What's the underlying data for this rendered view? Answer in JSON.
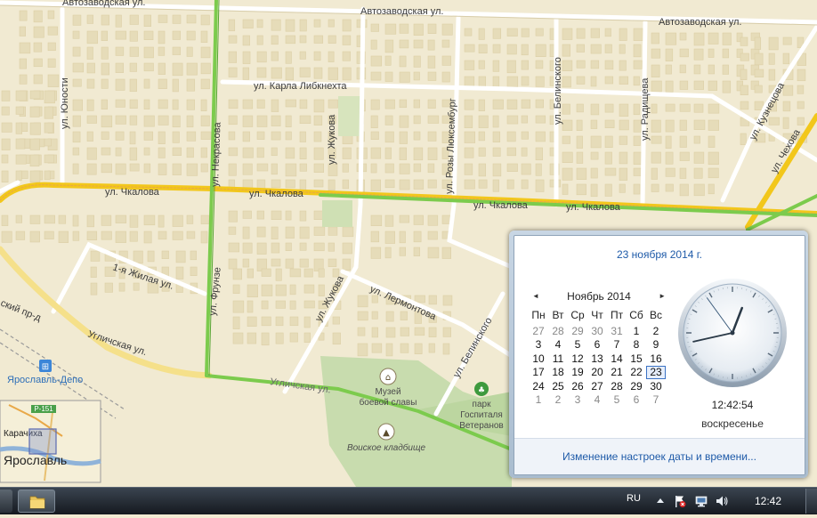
{
  "map": {
    "streets": {
      "avtozavodskaya_1": "Автозаводская ул.",
      "avtozavodskaya_2": "Автозаводская ул.",
      "karla_libknehta": "ул. Карла Либкнехта",
      "chkalova_1": "ул. Чкалова",
      "chkalova_2": "ул. Чкалова",
      "chkalova_3": "ул. Чкалова",
      "chkalova_4": "ул. Чкалова",
      "yunosti": "ул. Юности",
      "nekrasova_partial": "ул. Некрасова",
      "zhukova_1": "ул. Жукова",
      "zhukova_2": "ул. Жукова",
      "rozy_lyuksemburg": "ул. Розы Люксембург",
      "belinskogo_1": "ул. Белинского",
      "belinskogo_2": "ул. Белинского",
      "radishcheva": "ул. Радищева",
      "kuznecova": "ул. Кузнецова",
      "zhilaya": "1-я Жилая ул.",
      "lermontova": "ул. Лермонтова",
      "uglichskaya_1": "Угличская ул.",
      "uglichskaya_2": "Угличская ул.",
      "frolova_partial": "ул. Фрунзе",
      "proezd_partial": "ский пр-д",
      "chekhova_partial": "ул. Чехова"
    },
    "pois": {
      "station": "Ярославль-Депо",
      "museum_line1": "Музей",
      "museum_line2": "боевой славы",
      "cemetery": "Воиское кладбище",
      "park_line1": "парк",
      "park_line2": "Госпиталя",
      "park_line3": "Ветеранов"
    },
    "minimap": {
      "road_label": "Р-151",
      "town": "Карачиха",
      "city": "Ярославль"
    },
    "colors": {
      "background": "#f1ead2",
      "block": "#e4dab8",
      "green_traffic": "#7ccb4d",
      "yellow_traffic": "#f2c71b"
    }
  },
  "calendar": {
    "header_date": "23 ноября 2014 г.",
    "month_title": "Ноябрь 2014",
    "prev_icon": "◄",
    "next_icon": "►",
    "weekdays": [
      "Пн",
      "Вт",
      "Ср",
      "Чт",
      "Пт",
      "Сб",
      "Вс"
    ],
    "weeks": [
      [
        {
          "d": "27",
          "cur": false
        },
        {
          "d": "28",
          "cur": false
        },
        {
          "d": "29",
          "cur": false
        },
        {
          "d": "30",
          "cur": false
        },
        {
          "d": "31",
          "cur": false
        },
        {
          "d": "1",
          "cur": true
        },
        {
          "d": "2",
          "cur": true
        }
      ],
      [
        {
          "d": "3",
          "cur": true
        },
        {
          "d": "4",
          "cur": true
        },
        {
          "d": "5",
          "cur": true
        },
        {
          "d": "6",
          "cur": true
        },
        {
          "d": "7",
          "cur": true
        },
        {
          "d": "8",
          "cur": true
        },
        {
          "d": "9",
          "cur": true
        }
      ],
      [
        {
          "d": "10",
          "cur": true
        },
        {
          "d": "11",
          "cur": true
        },
        {
          "d": "12",
          "cur": true
        },
        {
          "d": "13",
          "cur": true
        },
        {
          "d": "14",
          "cur": true
        },
        {
          "d": "15",
          "cur": true
        },
        {
          "d": "16",
          "cur": true
        }
      ],
      [
        {
          "d": "17",
          "cur": true
        },
        {
          "d": "18",
          "cur": true
        },
        {
          "d": "19",
          "cur": true
        },
        {
          "d": "20",
          "cur": true
        },
        {
          "d": "21",
          "cur": true
        },
        {
          "d": "22",
          "cur": true
        },
        {
          "d": "23",
          "cur": true,
          "today": true
        }
      ],
      [
        {
          "d": "24",
          "cur": true
        },
        {
          "d": "25",
          "cur": true
        },
        {
          "d": "26",
          "cur": true
        },
        {
          "d": "27",
          "cur": true
        },
        {
          "d": "28",
          "cur": true
        },
        {
          "d": "29",
          "cur": true
        },
        {
          "d": "30",
          "cur": true
        }
      ],
      [
        {
          "d": "1",
          "cur": false
        },
        {
          "d": "2",
          "cur": false
        },
        {
          "d": "3",
          "cur": false
        },
        {
          "d": "4",
          "cur": false
        },
        {
          "d": "5",
          "cur": false
        },
        {
          "d": "6",
          "cur": false
        },
        {
          "d": "7",
          "cur": false
        }
      ]
    ],
    "clock_time": "12:42:54",
    "clock_hands": {
      "hour": 12,
      "minute": 42,
      "second": 54
    },
    "day_name": "воскресенье",
    "change_settings_link": "Изменение настроек даты и времени..."
  },
  "taskbar": {
    "language": "RU",
    "clock": "12:42",
    "tray_icons": [
      "show-hidden-icons-arrow",
      "action-center-flag-icon",
      "network-icon",
      "volume-icon"
    ]
  }
}
